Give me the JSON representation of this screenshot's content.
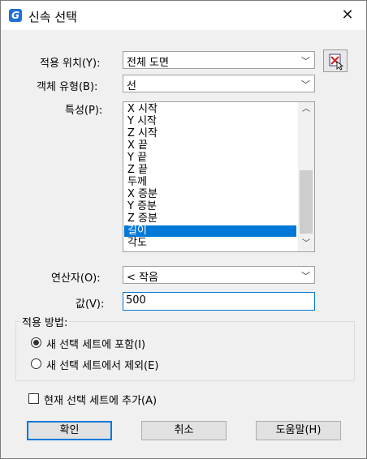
{
  "window": {
    "title": "신속 선택",
    "app_icon": "G",
    "close_glyph": "✕"
  },
  "apply_to": {
    "label": "적용 위치(Y):",
    "value": "전체 도면"
  },
  "object_type": {
    "label": "객체 유형(B):",
    "value": "선"
  },
  "properties": {
    "label": "특성(P):",
    "items": [
      "X 시작",
      "Y 시작",
      "Z 시작",
      "X 끝",
      "Y 끝",
      "Z 끝",
      "두께",
      "X 증분",
      "Y 증분",
      "Z 증분",
      "길이",
      "각도"
    ],
    "selected_index": 10
  },
  "operator": {
    "label": "연산자(O):",
    "value": "< 작음"
  },
  "value": {
    "label": "값(V):",
    "text": "500"
  },
  "how_to_apply": {
    "label": "적용 방법:",
    "option_include": "새 선택 세트에 포함(I)",
    "option_exclude": "새 선택 세트에서 제외(E)",
    "selected": "include"
  },
  "append": {
    "label": "현재 선택 세트에 추가(A)",
    "checked": false
  },
  "buttons": {
    "ok": "확인",
    "cancel": "취소",
    "help": "도움말(H)"
  },
  "colors": {
    "accent": "#0078d7",
    "selection": "#0078d7",
    "app_icon": "#1f6fd6"
  }
}
